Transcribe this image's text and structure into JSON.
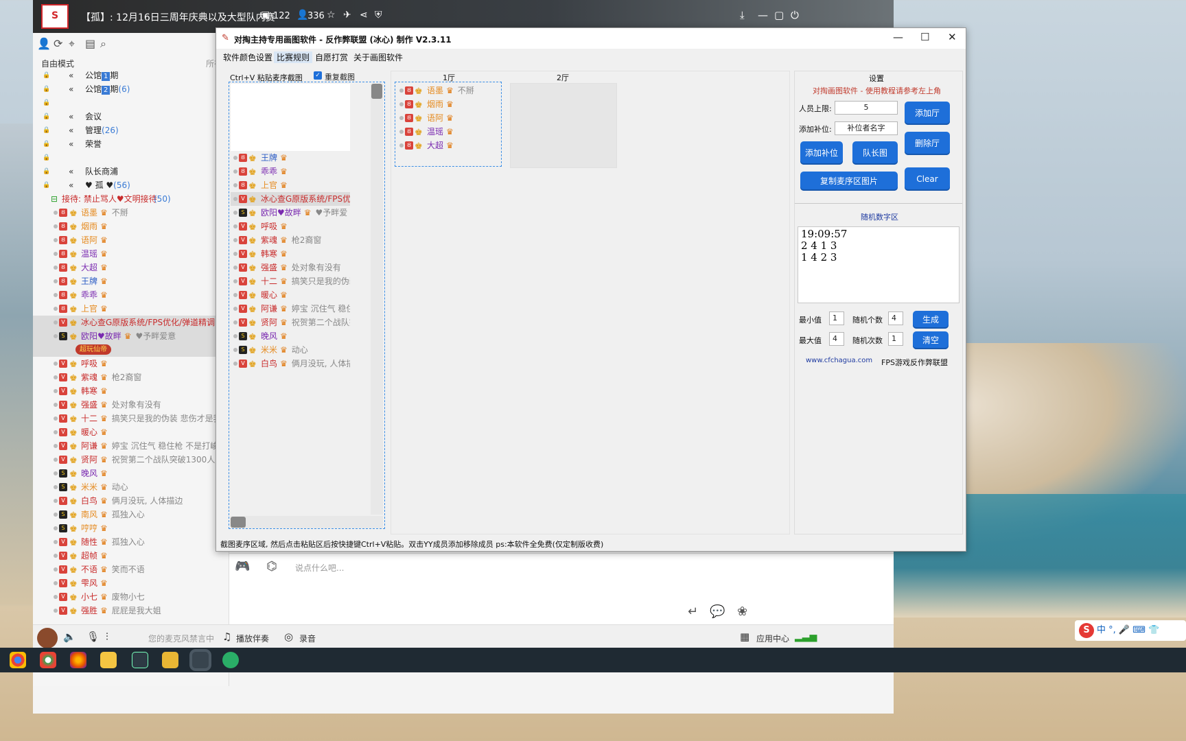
{
  "yy": {
    "title": "【孤】: 12月16日三周年庆典以及大型队内赛",
    "stat1": "122",
    "stat2": "336",
    "logo": "S",
    "mode": "自由模式",
    "mode_right": "所有",
    "tree": [
      {
        "label": "公馆",
        "badge": "1",
        "suffix": "期",
        "count": ""
      },
      {
        "label": "公馆",
        "badge": "2",
        "suffix": "期",
        "count": "(6)"
      },
      {
        "label": "",
        "badge": "",
        "suffix": "",
        "count": ""
      },
      {
        "label": "会议",
        "badge": "",
        "suffix": "",
        "count": ""
      },
      {
        "label": "管理",
        "badge": "",
        "suffix": "",
        "count": "(26)"
      },
      {
        "label": "荣誉",
        "badge": "",
        "suffix": "",
        "count": ""
      },
      {
        "label": "",
        "badge": "",
        "suffix": "",
        "count": ""
      },
      {
        "label": "队长商浦",
        "badge": "",
        "suffix": "",
        "count": ""
      },
      {
        "label": "♥ 孤 ♥",
        "badge": "",
        "suffix": "",
        "count": "(56)"
      }
    ],
    "reception": "接待: 禁止骂人♥文明接待",
    "reception_count": "(50)",
    "members": [
      {
        "name": "语墨",
        "badge": "♛",
        "sig": "不掰",
        "color": "n-orange",
        "vb": "Ȣ",
        "vbc": ""
      },
      {
        "name": "烟雨",
        "badge": "♛",
        "sig": "",
        "color": "n-orange",
        "vb": "Ȣ",
        "vbc": ""
      },
      {
        "name": "语阿",
        "badge": "♛",
        "sig": "",
        "color": "n-orange",
        "vb": "Ȣ",
        "vbc": ""
      },
      {
        "name": "温瑶",
        "badge": "♛",
        "sig": "",
        "color": "n-purple",
        "vb": "Ȣ",
        "vbc": ""
      },
      {
        "name": "大超",
        "badge": "♛",
        "sig": "",
        "color": "n-purple",
        "vb": "Ȣ",
        "vbc": ""
      },
      {
        "name": "王牌",
        "badge": "♛",
        "sig": "",
        "color": "n-blue",
        "vb": "Ȣ",
        "vbc": ""
      },
      {
        "name": "乖乖",
        "badge": "♛",
        "sig": "",
        "color": "n-purple",
        "vb": "Ȣ",
        "vbc": ""
      },
      {
        "name": "上官",
        "badge": "♛",
        "sig": "",
        "color": "n-orange",
        "vb": "Ȣ",
        "vbc": ""
      },
      {
        "name": "冰心查G原版系统/FPS优化/弹道精调",
        "badge": "♛",
        "sig": "",
        "color": "n-red",
        "vb": "V",
        "vbc": "",
        "hl": true
      },
      {
        "name": "欧阳♥故畔",
        "badge": "♛",
        "sig": "♥予畔爱意",
        "color": "n-purple",
        "vb": "S",
        "vbc": "k",
        "hl": true
      },
      {
        "name": "",
        "badge": "超玩仙帝",
        "sig": "",
        "color": "n-red",
        "vb": "",
        "vbc": "",
        "hl": true,
        "tag": true
      },
      {
        "name": "呼吸",
        "badge": "♛",
        "sig": "",
        "color": "n-red",
        "vb": "V",
        "vbc": ""
      },
      {
        "name": "紫魂",
        "badge": "♛",
        "sig": "枪2裔窗",
        "color": "n-red",
        "vb": "V",
        "vbc": ""
      },
      {
        "name": "韩寒",
        "badge": "♛",
        "sig": "",
        "color": "n-red",
        "vb": "V",
        "vbc": ""
      },
      {
        "name": "强盛",
        "badge": "♛",
        "sig": "处对象有没有",
        "color": "n-red",
        "vb": "V",
        "vbc": ""
      },
      {
        "name": "十二",
        "badge": "♛",
        "sig": "搞笑只是我的伪装 悲伤才是我",
        "color": "n-red",
        "vb": "V",
        "vbc": ""
      },
      {
        "name": "暖心",
        "badge": "♛",
        "sig": "",
        "color": "n-red",
        "vb": "V",
        "vbc": ""
      },
      {
        "name": "阿谦",
        "badge": "♛",
        "sig": "婷宝 沉住气 稳住枪 不是打峻",
        "color": "n-red",
        "vb": "V",
        "vbc": ""
      },
      {
        "name": "贤阿",
        "badge": "♛",
        "sig": "祝贺第二个战队突破1300人!",
        "color": "n-red",
        "vb": "V",
        "vbc": ""
      },
      {
        "name": "晚风",
        "badge": "♛",
        "sig": "",
        "color": "n-purple",
        "vb": "S",
        "vbc": "k"
      },
      {
        "name": "米米",
        "badge": "♛",
        "sig": "动心",
        "color": "n-orange",
        "vb": "S",
        "vbc": "k"
      },
      {
        "name": "白鸟",
        "badge": "♛",
        "sig": "俩月没玩, 人体描边",
        "color": "n-red",
        "vb": "V",
        "vbc": ""
      },
      {
        "name": "南风",
        "badge": "♛",
        "sig": "孤独入心",
        "color": "n-orange",
        "vb": "S",
        "vbc": "k"
      },
      {
        "name": "哼哼",
        "badge": "♛",
        "sig": "",
        "color": "n-orange",
        "vb": "S",
        "vbc": "k"
      },
      {
        "name": "随性",
        "badge": "♛",
        "sig": "孤独入心",
        "color": "n-red",
        "vb": "V",
        "vbc": ""
      },
      {
        "name": "超帧",
        "badge": "♛",
        "sig": "",
        "color": "n-red",
        "vb": "V",
        "vbc": ""
      },
      {
        "name": "不语",
        "badge": "♛",
        "sig": "笑而不语",
        "color": "n-red",
        "vb": "V",
        "vbc": ""
      },
      {
        "name": "雫风",
        "badge": "♛",
        "sig": "",
        "color": "n-red",
        "vb": "V",
        "vbc": ""
      },
      {
        "name": "小七",
        "badge": "♛",
        "sig": "废物小七",
        "color": "n-red",
        "vb": "V",
        "vbc": ""
      },
      {
        "name": "强胜",
        "badge": "♛",
        "sig": "屁屁是我大姐",
        "color": "n-red",
        "vb": "V",
        "vbc": ""
      }
    ],
    "chat_placeholder": "说点什么吧...",
    "bottom": {
      "mic": "您的麦克风禁言中",
      "music": "播放伴奏",
      "record": "录音",
      "apps": "应用中心"
    }
  },
  "tool": {
    "title": "对掏主持专用画图软件 - 反作弊联盟 (冰心) 制作  V2.3.11",
    "menu": [
      "软件颜色设置",
      "比赛规则",
      "自愿打赏",
      "关于画图软件"
    ],
    "paste_head": "Ctrl+V 粘贴麦序截图",
    "repeat_label": "重复截图",
    "hall1": "1厅",
    "hall2": "2厅",
    "paste_list": [
      {
        "name": "王牌",
        "color": "n-blue",
        "vb": "Ȣ",
        "vbc": "",
        "sig": ""
      },
      {
        "name": "乖乖",
        "color": "n-purple",
        "vb": "Ȣ",
        "vbc": "",
        "sig": ""
      },
      {
        "name": "上官",
        "color": "n-orange",
        "vb": "Ȣ",
        "vbc": "",
        "sig": ""
      },
      {
        "name": "冰心查G原版系统/FPS优化/",
        "color": "n-red",
        "vb": "V",
        "vbc": "",
        "sig": "",
        "hl": true,
        "nocrown": true
      },
      {
        "name": "欧阳♥故畔",
        "color": "n-purple",
        "vb": "S",
        "vbc": "k",
        "sig": "♥予畔爱",
        "hl": false
      },
      {
        "name": "呼吸",
        "color": "n-red",
        "vb": "V",
        "vbc": "",
        "sig": ""
      },
      {
        "name": "紫魂",
        "color": "n-red",
        "vb": "V",
        "vbc": "",
        "sig": "枪2裔窗"
      },
      {
        "name": "韩寒",
        "color": "n-red",
        "vb": "V",
        "vbc": "",
        "sig": ""
      },
      {
        "name": "强盛",
        "color": "n-red",
        "vb": "V",
        "vbc": "",
        "sig": "处对象有没有"
      },
      {
        "name": "十二",
        "color": "n-red",
        "vb": "V",
        "vbc": "",
        "sig": "搞笑只是我的伪装"
      },
      {
        "name": "暖心",
        "color": "n-red",
        "vb": "V",
        "vbc": "",
        "sig": ""
      },
      {
        "name": "阿谦",
        "color": "n-red",
        "vb": "V",
        "vbc": "",
        "sig": "婷宝 沉住气 稳住"
      },
      {
        "name": "贤阿",
        "color": "n-red",
        "vb": "V",
        "vbc": "",
        "sig": "祝贺第二个战队突"
      },
      {
        "name": "晚风",
        "color": "n-purple",
        "vb": "S",
        "vbc": "k",
        "sig": ""
      },
      {
        "name": "米米",
        "color": "n-orange",
        "vb": "S",
        "vbc": "k",
        "sig": "动心"
      },
      {
        "name": "白鸟",
        "color": "n-red",
        "vb": "V",
        "vbc": "",
        "sig": "俩月没玩, 人体描"
      }
    ],
    "hall1_list": [
      {
        "name": "语墨",
        "color": "n-orange",
        "sig": "不掰"
      },
      {
        "name": "烟雨",
        "color": "n-orange",
        "sig": ""
      },
      {
        "name": "语阿",
        "color": "n-orange",
        "sig": ""
      },
      {
        "name": "温瑶",
        "color": "n-purple",
        "sig": ""
      },
      {
        "name": "大超",
        "color": "n-purple",
        "sig": ""
      }
    ],
    "settings": {
      "title": "设置",
      "note": "对掏画图软件 - 使用教程请参考左上角",
      "max_label": "人员上限:",
      "max_value": "5",
      "sub_label": "添加补位:",
      "sub_value": "补位者名字",
      "btn_add_hall": "添加厅",
      "btn_del_hall": "删除厅",
      "btn_add_sub": "添加补位",
      "btn_captain": "队长图",
      "btn_copy": "复制麦序区图片",
      "btn_clear": "Clear",
      "rand_title": "随机数字区",
      "rand_text": "19:09:57\n2 4 1 3\n1 4 2 3",
      "min_label": "最小值",
      "min_value": "1",
      "count_label": "随机个数",
      "count_value": "4",
      "maxv_label": "最大值",
      "maxv_value": "4",
      "times_label": "随机次数",
      "times_value": "1",
      "btn_gen": "生成",
      "btn_clr": "清空",
      "link": "www.cfchagua.com",
      "link2": "FPS游戏反作弊联盟"
    },
    "status": "截图麦序区域, 然后点击粘贴区后按快捷键Ctrl+V粘贴。双击YY成员添加移除成员  ps:本软件全免费(仅定制版收费)"
  },
  "ime": {
    "text": "中 °, 🎤 ⌨ 👕"
  }
}
